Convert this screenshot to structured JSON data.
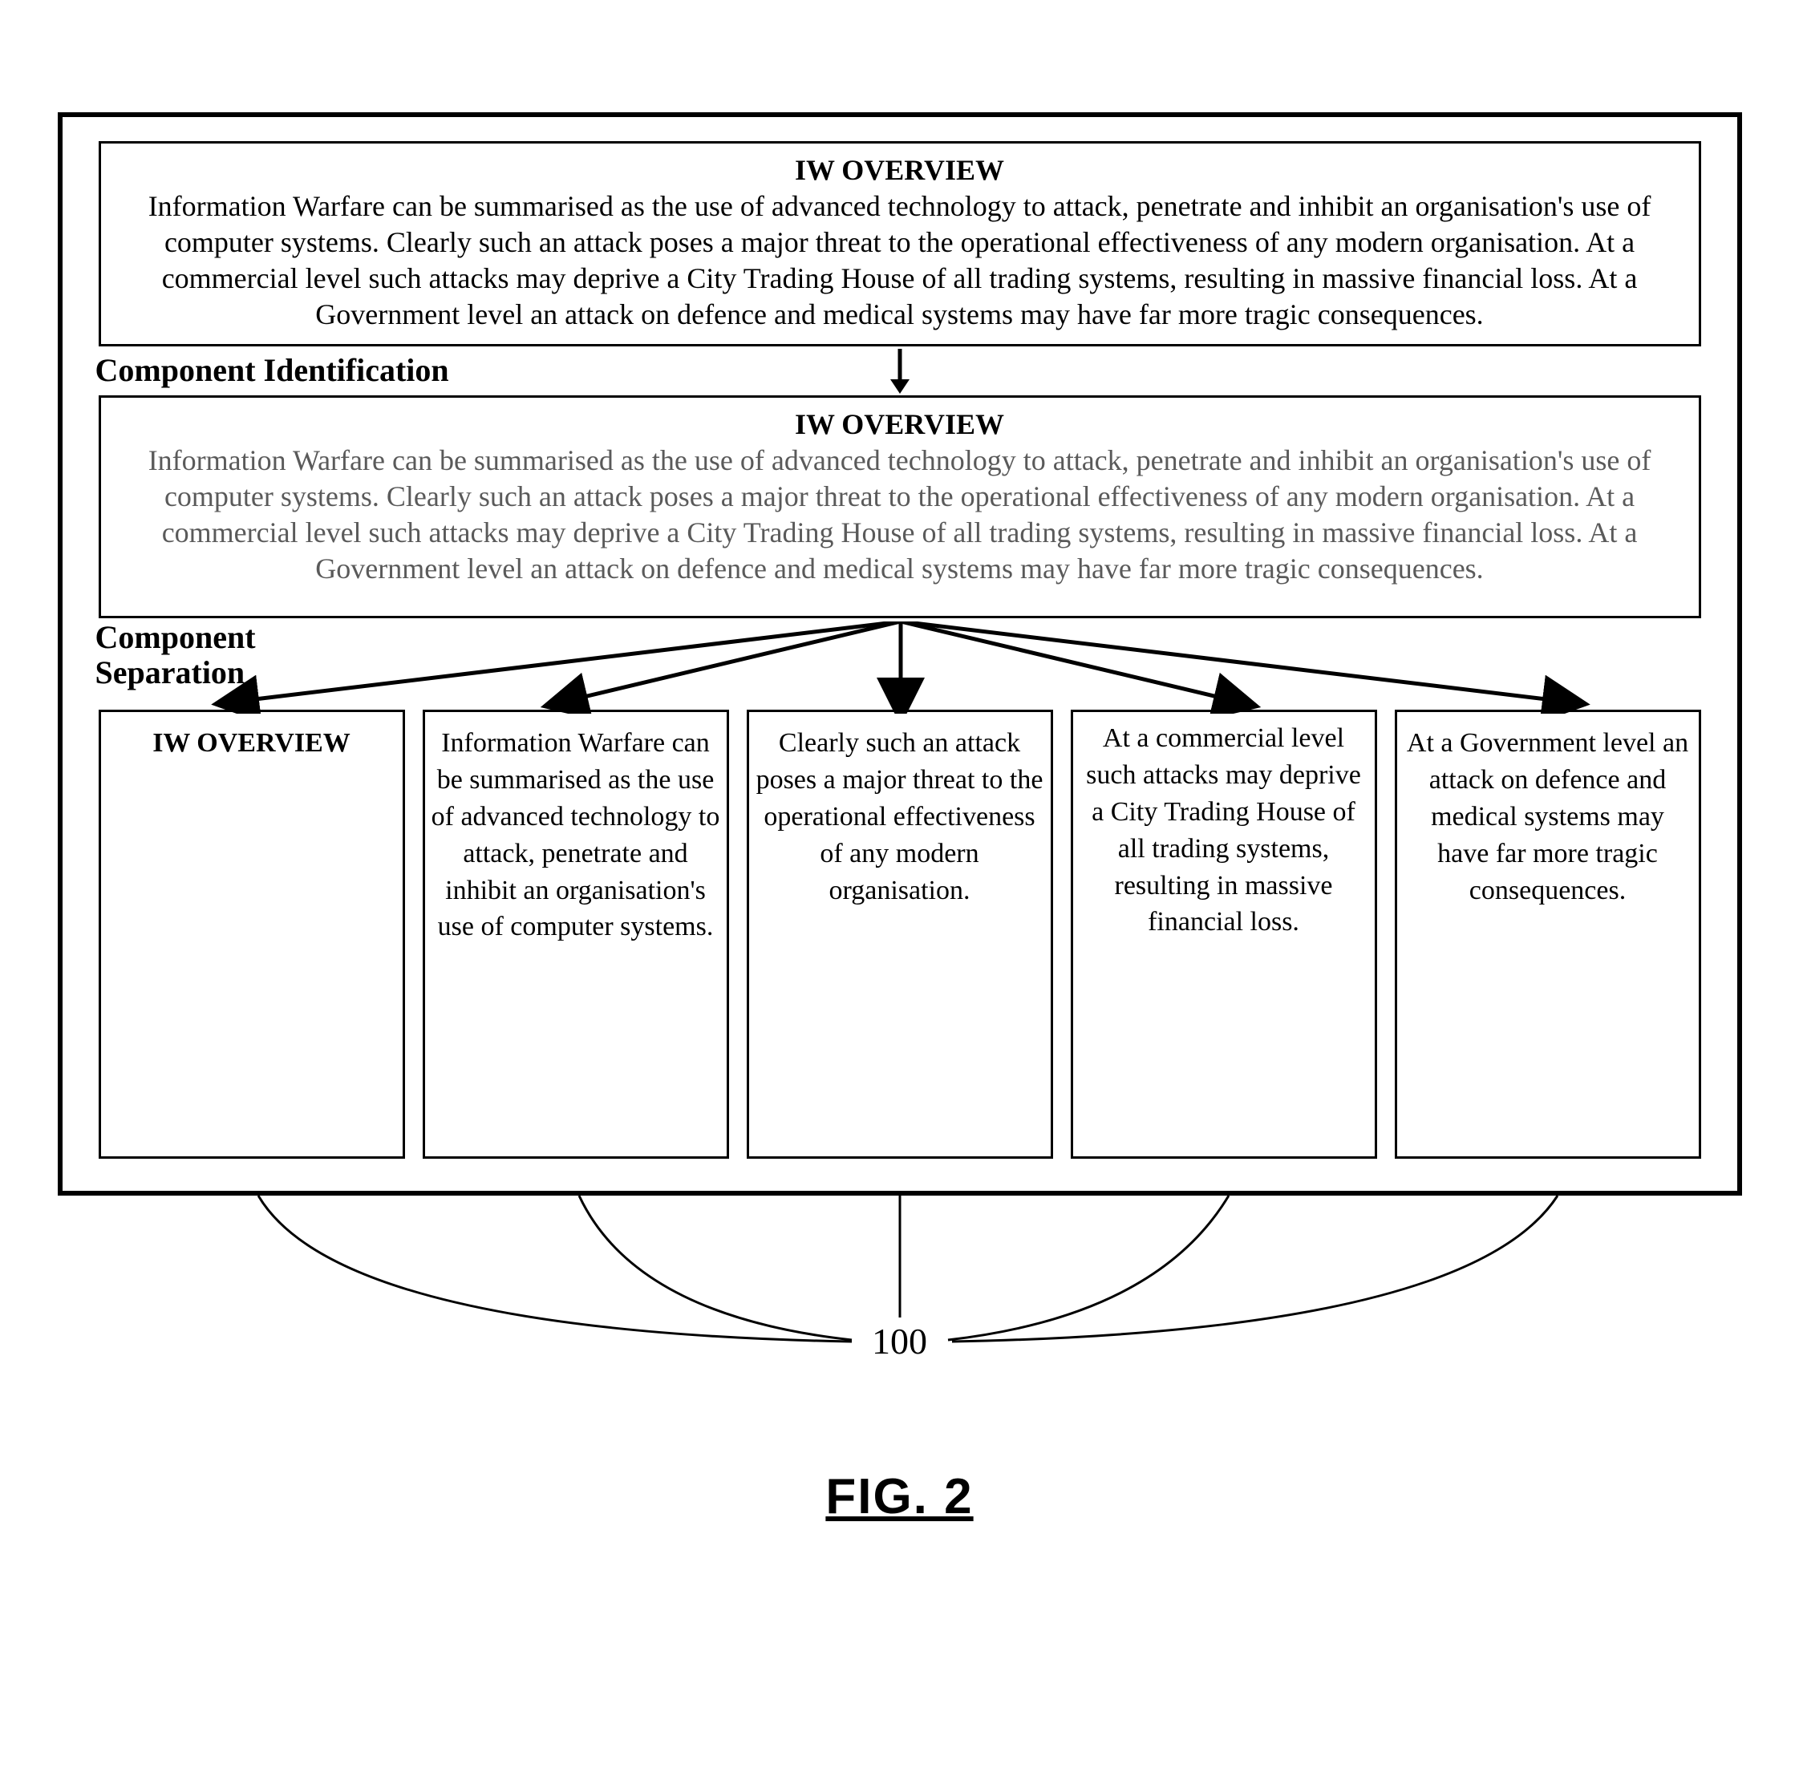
{
  "overview1": {
    "title": "IW OVERVIEW",
    "body": "Information Warfare can be summarised as the use of advanced technology to attack, penetrate and inhibit an organisation's use of computer systems.  Clearly such an attack poses a major threat to the operational effectiveness of any modern organisation.  At a commercial level such attacks may deprive a City Trading House of all trading systems, resulting in massive financial loss.  At a Government level an attack on defence and medical systems may have far more tragic consequences."
  },
  "stage1_label": "Component Identification",
  "overview2": {
    "title": "IW OVERVIEW",
    "body": "Information Warfare can be summarised as the use of advanced technology to attack, penetrate and inhibit an organisation's use of computer systems.  Clearly such an attack poses a major threat to the operational effectiveness of any modern organisation.  At a commercial level such attacks may deprive a City Trading House of all trading systems, resulting in massive financial loss.  At a Government level an attack on defence and medical systems may have far more tragic consequences."
  },
  "stage2_label": "Component Separation",
  "components": [
    "IW OVERVIEW",
    "Information Warfare can be summarised as the use of advanced technology to attack, penetrate and inhibit an organisation's use of computer systems.",
    "Clearly such an attack poses a major threat to the operational effectiveness of any modern organisation.",
    "At a commercial level such attacks may deprive a City Trading House of all trading systems, resulting in massive financial loss.",
    "At a Government level an attack on defence and medical systems may have far more tragic consequences."
  ],
  "reference_number": "100",
  "figure_label": "FIG. 2"
}
